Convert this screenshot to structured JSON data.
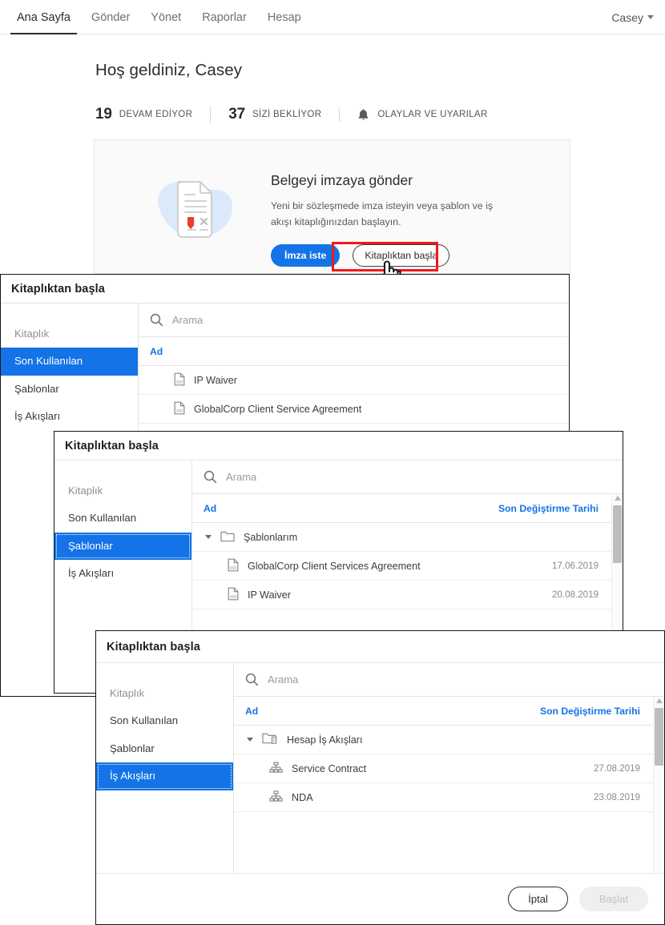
{
  "topnav": {
    "items": [
      {
        "label": "Ana Sayfa",
        "active": true
      },
      {
        "label": "Gönder",
        "active": false
      },
      {
        "label": "Yönet",
        "active": false
      },
      {
        "label": "Raporlar",
        "active": false
      },
      {
        "label": "Hesap",
        "active": false
      }
    ],
    "user": "Casey",
    "user_caret_icon": "chevron-down-icon"
  },
  "page": {
    "title": "Hoş geldiniz, Casey",
    "stats": [
      {
        "num": "19",
        "label": "DEVAM EDİYOR",
        "icon": ""
      },
      {
        "num": "37",
        "label": "SİZİ BEKLİYOR",
        "icon": ""
      },
      {
        "num": "",
        "label": "OLAYLAR VE UYARILAR",
        "icon": "bell-icon"
      }
    ]
  },
  "hero": {
    "illustration_icon": "document-signature-icon",
    "heading": "Belgeyi imzaya gönder",
    "paragraph": "Yeni bir sözleşmede imza isteyin veya şablon ve iş akışı kitaplığınızdan başlayın.",
    "primary_button": "İmza iste",
    "secondary_button": "Kitaplıktan başla",
    "annotation_color": "#f3171b",
    "cursor_icon": "hand-pointer-cursor"
  },
  "dialog_common": {
    "title": "Kitaplıktan başla",
    "search_placeholder": "Arama",
    "search_icon": "search-icon",
    "sidebar_header": "Kitaplık",
    "sidebar_items": [
      "Son Kullanılan",
      "Şablonlar",
      "İş Akışları"
    ],
    "col_name": "Ad",
    "col_date": "Son Değiştirme Tarihi",
    "accent_color": "#1473e6"
  },
  "dialog1": {
    "selected": "Son Kullanılan",
    "show_date_col": false,
    "rows": [
      {
        "name": "IP Waiver",
        "date": "",
        "icon": "document-icon",
        "level": "doc"
      },
      {
        "name": "GlobalCorp Client Service Agreement",
        "date": "",
        "icon": "document-icon",
        "level": "doc"
      }
    ]
  },
  "dialog2": {
    "selected": "Şablonlar",
    "show_date_col": true,
    "rows": [
      {
        "name": "Şablonlarım",
        "date": "",
        "icon": "folder-icon",
        "level": "folder"
      },
      {
        "name": "GlobalCorp Client Services Agreement",
        "date": "17.06.2019",
        "icon": "document-icon",
        "level": "doc"
      },
      {
        "name": "IP Waiver",
        "date": "20.08.2019",
        "icon": "document-icon",
        "level": "doc"
      }
    ]
  },
  "dialog3": {
    "selected": "İş Akışları",
    "show_date_col": true,
    "rows": [
      {
        "name": "Hesap İş Akışları",
        "date": "",
        "icon": "folder-account-icon",
        "level": "folder"
      },
      {
        "name": "Service Contract",
        "date": "27.08.2019",
        "icon": "workflow-icon",
        "level": "doc"
      },
      {
        "name": "NDA",
        "date": "23.08.2019",
        "icon": "workflow-icon",
        "level": "doc"
      }
    ],
    "footer": {
      "cancel_button": "İptal",
      "start_button": "Başlat",
      "start_disabled": true
    }
  }
}
